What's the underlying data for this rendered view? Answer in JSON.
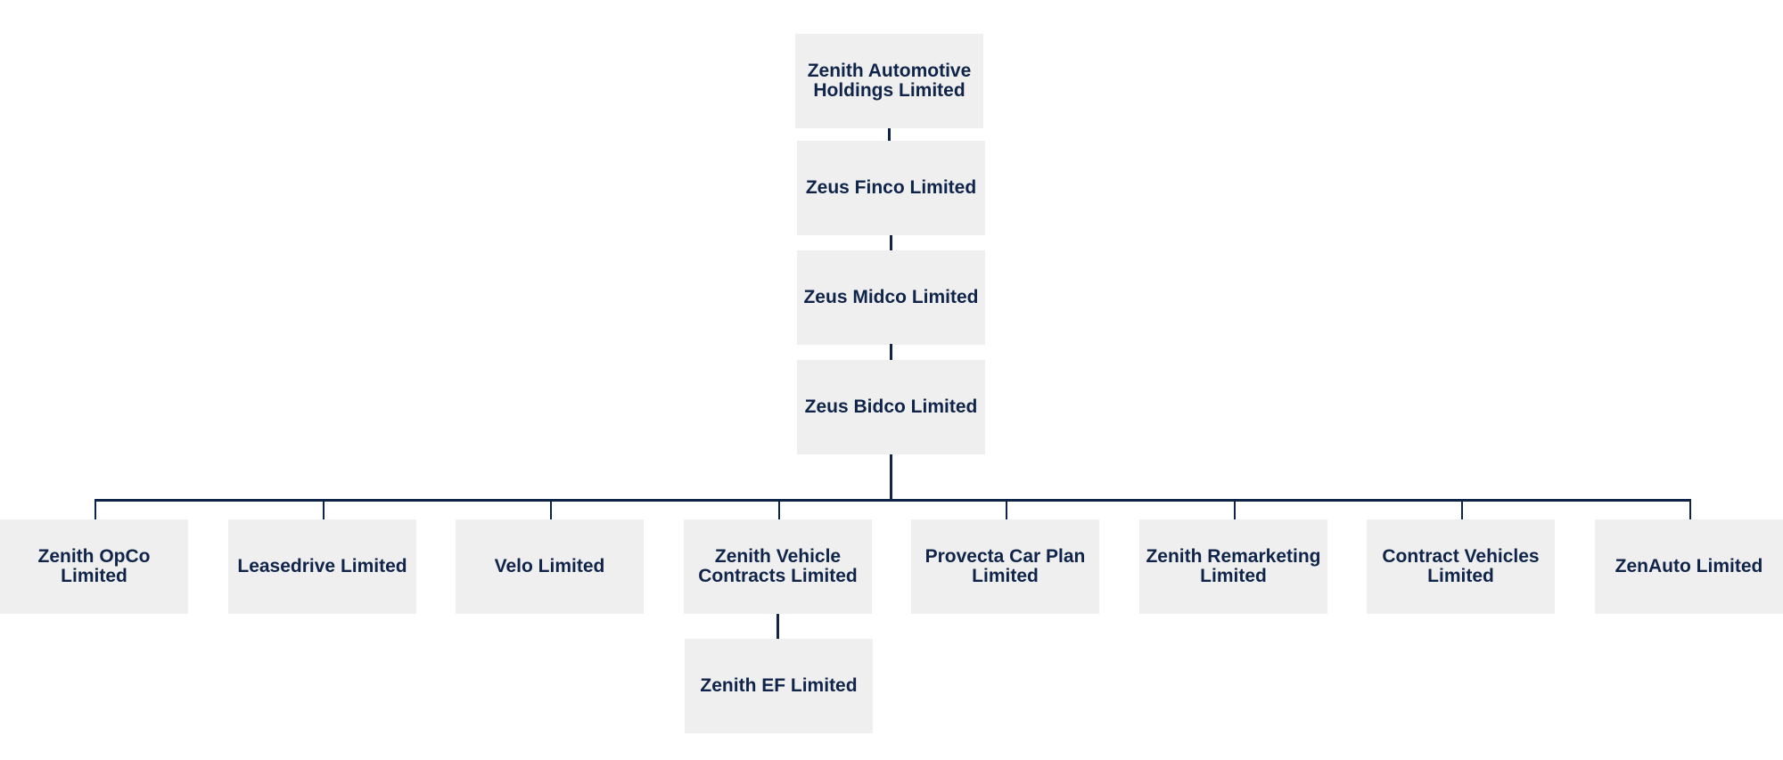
{
  "chart_data": {
    "type": "org-chart",
    "nodes": [
      {
        "id": "root",
        "label": "Zenith Automotive Holdings Limited",
        "parent": null
      },
      {
        "id": "finco",
        "label": "Zeus Finco Limited",
        "parent": "root"
      },
      {
        "id": "midco",
        "label": "Zeus Midco Limited",
        "parent": "finco"
      },
      {
        "id": "bidco",
        "label": "Zeus Bidco Limited",
        "parent": "midco"
      },
      {
        "id": "opco",
        "label": "Zenith OpCo Limited",
        "parent": "bidco"
      },
      {
        "id": "leasedrive",
        "label": "Leasedrive Limited",
        "parent": "bidco"
      },
      {
        "id": "velo",
        "label": "Velo Limited",
        "parent": "bidco"
      },
      {
        "id": "zvc",
        "label": "Zenith Vehicle Contracts Limited",
        "parent": "bidco"
      },
      {
        "id": "provecta",
        "label": "Provecta Car Plan Limited",
        "parent": "bidco"
      },
      {
        "id": "remarketing",
        "label": "Zenith Remarketing Limited",
        "parent": "bidco"
      },
      {
        "id": "contract",
        "label": "Contract Vehicles Limited",
        "parent": "bidco"
      },
      {
        "id": "zenauto",
        "label": "ZenAuto Limited",
        "parent": "bidco"
      },
      {
        "id": "ef",
        "label": "Zenith EF Limited",
        "parent": "zvc"
      }
    ],
    "colors": {
      "box": "#efefef",
      "text": "#10244a",
      "line": "#10244a"
    }
  }
}
